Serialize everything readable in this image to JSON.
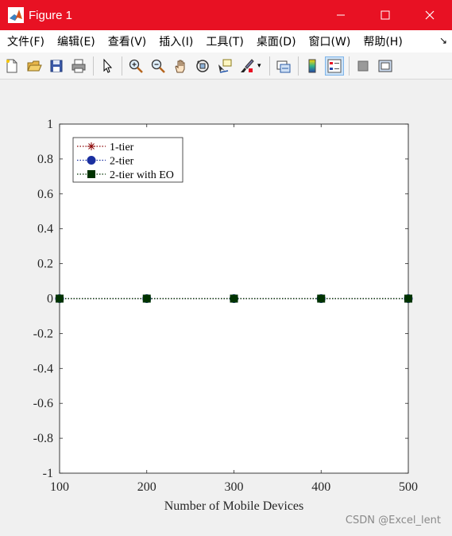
{
  "window": {
    "title": "Figure 1",
    "accent_color": "#e81123"
  },
  "menu": {
    "items": [
      "文件(F)",
      "编辑(E)",
      "查看(V)",
      "插入(I)",
      "工具(T)",
      "桌面(D)",
      "窗口(W)",
      "帮助(H)"
    ],
    "overflow_icon": "arrow-icon"
  },
  "toolbar": {
    "buttons": [
      "new-figure-icon",
      "open-file-icon",
      "save-icon",
      "print-icon",
      "pointer-icon",
      "zoom-in-icon",
      "zoom-out-icon",
      "pan-icon",
      "rotate-3d-icon",
      "data-cursor-icon",
      "brush-icon",
      "link-plot-icon",
      "colorbar-icon",
      "legend-icon",
      "hide-plot-tools-icon",
      "show-plot-tools-icon"
    ]
  },
  "watermark": "CSDN @Excel_lent",
  "chart_data": {
    "type": "line",
    "x": [
      100,
      200,
      300,
      400,
      500
    ],
    "xlabel": "Number of Mobile Devices",
    "ylabel": "",
    "title": "",
    "xlim": [
      100,
      500
    ],
    "ylim": [
      -1,
      1
    ],
    "xticks": [
      "100",
      "200",
      "300",
      "400",
      "500"
    ],
    "yticks": [
      "-1",
      "-0.8",
      "-0.6",
      "-0.4",
      "-0.2",
      "0",
      "0.2",
      "0.4",
      "0.6",
      "0.8",
      "1"
    ],
    "grid": false,
    "legend_position": "top-left",
    "series": [
      {
        "name": "1-tier",
        "values": [
          0,
          0,
          0,
          0,
          0
        ],
        "color": "#8b0000",
        "marker": "asterisk",
        "linestyle": "dotted"
      },
      {
        "name": "2-tier",
        "values": [
          0,
          0,
          0,
          0,
          0
        ],
        "color": "#1a2fa0",
        "marker": "circle",
        "linestyle": "dotted"
      },
      {
        "name": "2-tier with EO",
        "values": [
          0,
          0,
          0,
          0,
          0
        ],
        "color": "#003300",
        "marker": "square",
        "linestyle": "dotted"
      }
    ]
  }
}
